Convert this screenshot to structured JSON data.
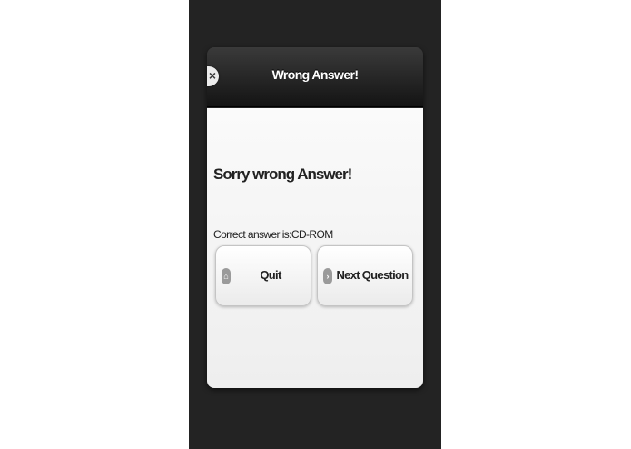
{
  "dialog": {
    "title": "Wrong Answer!",
    "close_icon": "close-icon",
    "heading": "Sorry wrong Answer!",
    "answer_text": "Correct answer is:CD-ROM"
  },
  "buttons": {
    "quit": {
      "label": "Quit",
      "icon": "home-icon"
    },
    "next": {
      "label": "Next Question",
      "icon": "arrow-right-icon"
    }
  },
  "colors": {
    "screen_background": "#232323",
    "header_background": "#1a1a1a",
    "body_background": "#f3f3f3"
  }
}
